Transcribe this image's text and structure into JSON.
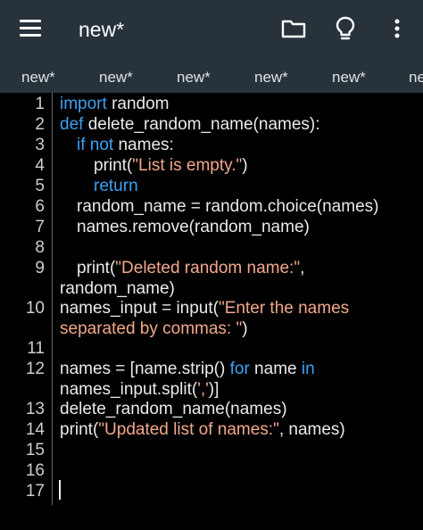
{
  "app_bar": {
    "title": "new*",
    "icons": [
      "menu-icon",
      "folder-icon",
      "lightbulb-icon",
      "more-vert-icon"
    ]
  },
  "tabs": [
    "new*",
    "new*",
    "new*",
    "new*",
    "new*",
    "ne"
  ],
  "colors": {
    "toolbar_bg": "#27323a",
    "editor_bg": "#000000",
    "keyword": "#3da1f0",
    "string": "#f2a88b",
    "text": "#e8eaeb"
  },
  "editor": {
    "line_numbers": [
      "1",
      "2",
      "3",
      "4",
      "5",
      "6",
      "7",
      "8",
      "9",
      "10",
      "11",
      "12",
      "13",
      "14",
      "15",
      "16",
      "17"
    ],
    "code": {
      "l1_kw": "import",
      "l1_rest": " random",
      "l2_kw": "def",
      "l2_rest": " delete_random_name(names):",
      "l3_kw1": "if",
      "l3_kw2": "not",
      "l3_rest": " names:",
      "l4_a": "print(",
      "l4_str": "\"List is empty.\"",
      "l4_b": ")",
      "l5_kw": "return",
      "l6": "random_name = random.choice(names)",
      "l7": "names.remove(random_name)",
      "l9_a": "print(",
      "l9_str": "\"Deleted random name:\"",
      "l9_b": ",",
      "l9_wrap": "random_name)",
      "l10_a": "names_input = input(",
      "l10_str": "\"Enter the names",
      "l10_wrap_str": "separated by commas: \"",
      "l10_wrap_b": ")",
      "l12_a": "names = [name.strip() ",
      "l12_kw1": "for",
      "l12_b": " name ",
      "l12_kw2": "in",
      "l12_wrap_a": "names_input.split(",
      "l12_wrap_str": "','",
      "l12_wrap_b": ")]",
      "l13": "delete_random_name(names)",
      "l14_a": "print(",
      "l14_str": "\"Updated list of names:\"",
      "l14_b": ", names)"
    }
  }
}
